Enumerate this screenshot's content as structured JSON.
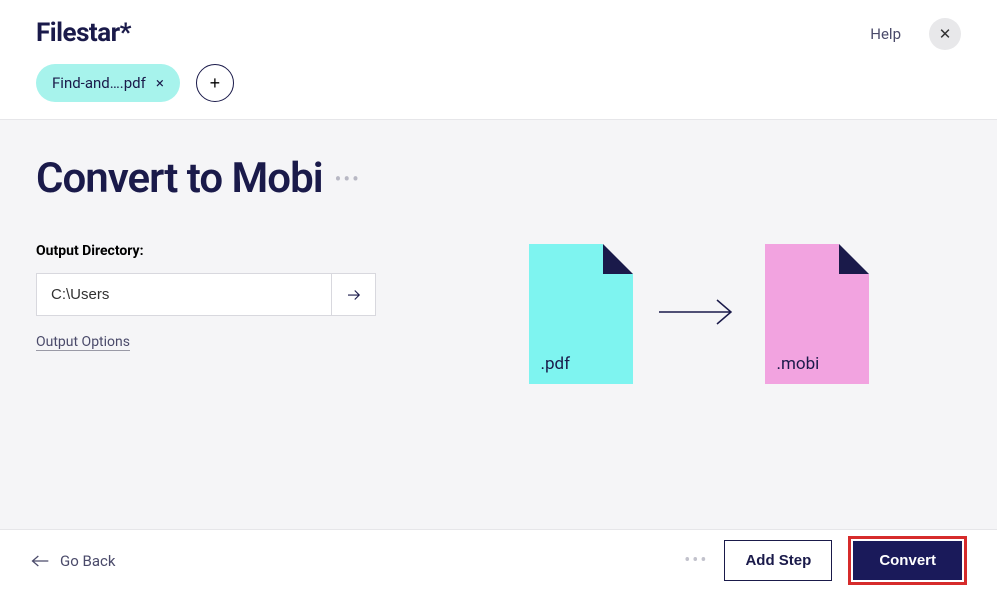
{
  "logo": "Filestar*",
  "help": "Help",
  "file_chip": {
    "name": "Find-and….pdf"
  },
  "title": "Convert to Mobi",
  "output_dir_label": "Output Directory:",
  "output_dir_value": "C:\\Users",
  "output_options": "Output Options",
  "ext_from": ".pdf",
  "ext_to": ".mobi",
  "go_back": "Go Back",
  "add_step": "Add Step",
  "convert": "Convert"
}
